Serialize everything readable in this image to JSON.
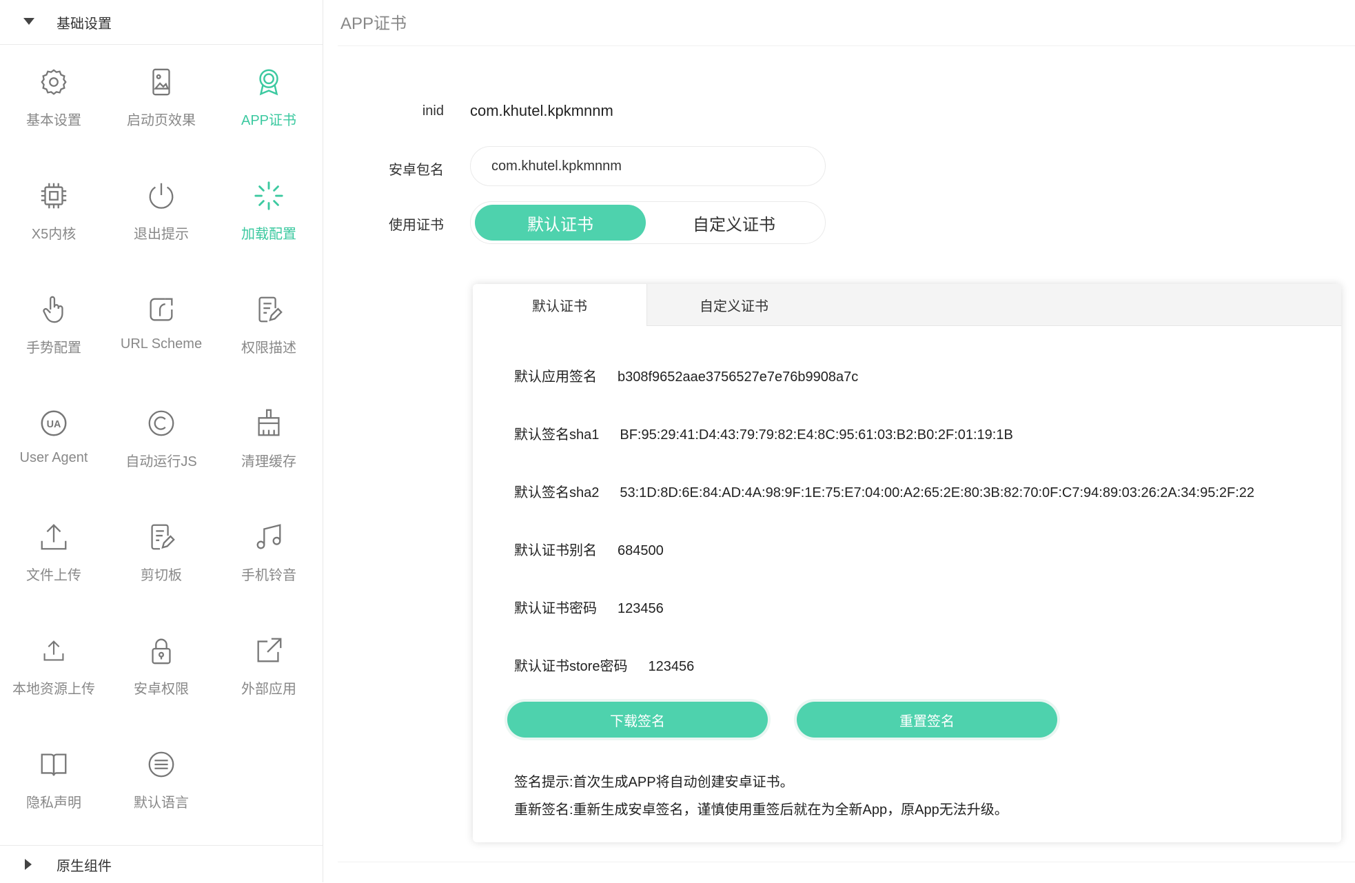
{
  "sidebar": {
    "section_basic": "基础设置",
    "section_native": "原生组件",
    "items": [
      {
        "label": "基本设置",
        "icon": "gear-icon"
      },
      {
        "label": "启动页效果",
        "icon": "splash-image-icon"
      },
      {
        "label": "APP证书",
        "icon": "certificate-badge-icon"
      },
      {
        "label": "X5内核",
        "icon": "chip-icon"
      },
      {
        "label": "退出提示",
        "icon": "power-icon"
      },
      {
        "label": "加载配置",
        "icon": "loading-spinner-icon"
      },
      {
        "label": "手势配置",
        "icon": "hand-pointer-icon"
      },
      {
        "label": "URL Scheme",
        "icon": "link-scheme-icon"
      },
      {
        "label": "权限描述",
        "icon": "edit-document-icon"
      },
      {
        "label": "User Agent",
        "icon": "ua-icon"
      },
      {
        "label": "自动运行JS",
        "icon": "copyright-icon"
      },
      {
        "label": "清理缓存",
        "icon": "broom-icon"
      },
      {
        "label": "文件上传",
        "icon": "upload-icon"
      },
      {
        "label": "剪切板",
        "icon": "clipboard-edit-icon"
      },
      {
        "label": "手机铃音",
        "icon": "music-note-icon"
      },
      {
        "label": "本地资源上传",
        "icon": "local-upload-icon"
      },
      {
        "label": "安卓权限",
        "icon": "lock-icon"
      },
      {
        "label": "外部应用",
        "icon": "external-link-icon"
      },
      {
        "label": "隐私声明",
        "icon": "book-icon"
      },
      {
        "label": "默认语言",
        "icon": "language-icon"
      }
    ],
    "active_item": "APP证书",
    "accent_color": "#3cc9a0"
  },
  "main": {
    "title": "APP证书",
    "form": {
      "inid_label": "inid",
      "inid_value": "com.khutel.kpkmnnm",
      "package_label": "安卓包名",
      "package_value": "com.khutel.kpkmnnm",
      "cert_label": "使用证书",
      "toggle_default": "默认证书",
      "toggle_custom": "自定义证书",
      "toggle_selected": "默认证书"
    },
    "card": {
      "tabs": [
        "默认证书",
        "自定义证书"
      ],
      "active_tab": "默认证书",
      "rows": [
        {
          "key": "默认应用签名",
          "value": "b308f9652aae3756527e7e76b9908a7c"
        },
        {
          "key": "默认签名sha1",
          "value": "BF:95:29:41:D4:43:79:79:82:E4:8C:95:61:03:B2:B0:2F:01:19:1B"
        },
        {
          "key": "默认签名sha2",
          "value": "53:1D:8D:6E:84:AD:4A:98:9F:1E:75:E7:04:00:A2:65:2E:80:3B:82:70:0F:C7:94:89:03:26:2A:34:95:2F:22"
        },
        {
          "key": "默认证书别名",
          "value": "684500"
        },
        {
          "key": "默认证书密码",
          "value": "123456"
        },
        {
          "key": "默认证书store密码",
          "value": "123456"
        }
      ],
      "download_button": "下载签名",
      "reset_button": "重置签名",
      "hint_1": "签名提示:首次生成APP将自动创建安卓证书。",
      "hint_2": "重新签名:重新生成安卓签名，谨慎使用重签后就在为全新App，原App无法升级。",
      "button_color": "#4ed2ad"
    }
  }
}
